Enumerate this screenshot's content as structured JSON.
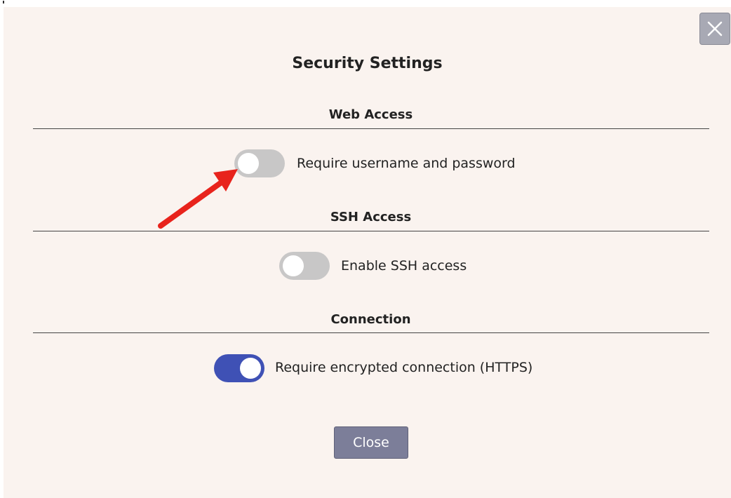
{
  "dialog": {
    "title": "Security Settings",
    "close_icon": "close-icon"
  },
  "sections": [
    {
      "title": "Web Access",
      "toggle_label": "Require username and password",
      "toggle_state": "off"
    },
    {
      "title": "SSH Access",
      "toggle_label": "Enable SSH access",
      "toggle_state": "off"
    },
    {
      "title": "Connection",
      "toggle_label": "Require encrypted connection (HTTPS)",
      "toggle_state": "on"
    }
  ],
  "footer": {
    "close_label": "Close"
  },
  "colors": {
    "background": "#faf3ef",
    "toggle_on": "#3f51b5",
    "toggle_off": "#c8c7c7",
    "close_button": "#7c7e99",
    "annotation_arrow": "#e8231c"
  }
}
